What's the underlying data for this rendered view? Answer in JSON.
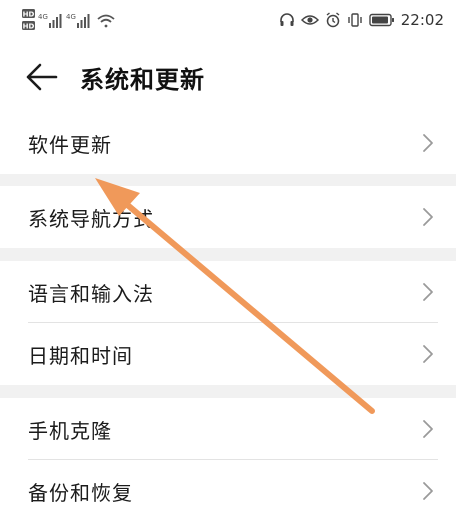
{
  "status_bar": {
    "sim1_badge": "HD",
    "sim2_badge": "HD",
    "net1": "4G",
    "net2": "4G",
    "time": "22:02"
  },
  "header": {
    "title": "系统和更新"
  },
  "groups": [
    {
      "items": [
        {
          "label": "软件更新"
        }
      ]
    },
    {
      "items": [
        {
          "label": "系统导航方式"
        }
      ]
    },
    {
      "items": [
        {
          "label": "语言和输入法"
        },
        {
          "label": "日期和时间"
        }
      ]
    },
    {
      "items": [
        {
          "label": "手机克隆"
        },
        {
          "label": "备份和恢复"
        }
      ]
    }
  ],
  "colors": {
    "annotation_arrow": "#f0995a",
    "background": "#f1f1f1",
    "card": "#ffffff"
  }
}
